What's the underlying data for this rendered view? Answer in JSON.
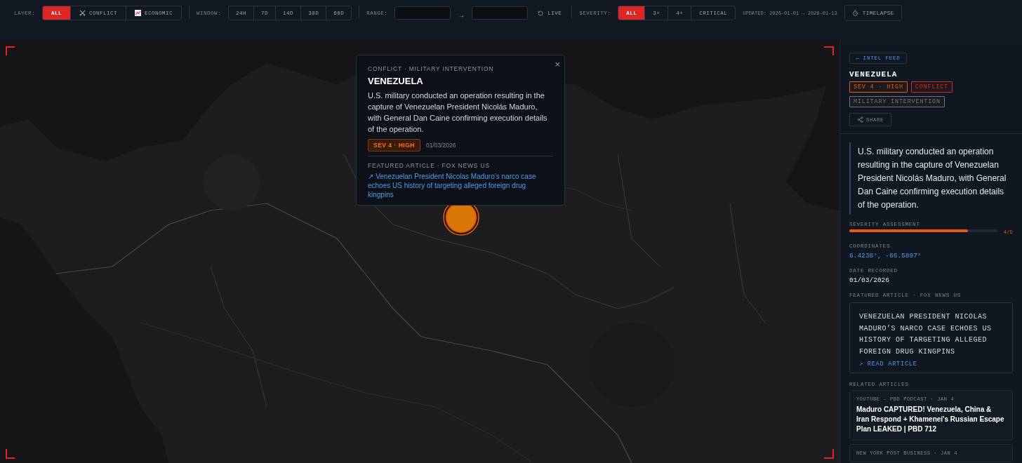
{
  "toolbar": {
    "layer": {
      "label": "LAYER:",
      "options": [
        {
          "label": "ALL",
          "kind": "plain",
          "selected": true
        },
        {
          "label": "CONFLICT",
          "kind": "conflict",
          "selected": false
        },
        {
          "label": "ECONOMIC",
          "kind": "economic",
          "selected": false
        }
      ]
    },
    "window": {
      "label": "WINDOW:",
      "options": [
        {
          "label": "24H",
          "selected": false
        },
        {
          "label": "7D",
          "selected": false
        },
        {
          "label": "14D",
          "selected": false
        },
        {
          "label": "30D",
          "selected": false
        },
        {
          "label": "60D",
          "selected": false
        }
      ]
    },
    "range": {
      "label": "RANGE:",
      "arrow": "→"
    },
    "live": {
      "label": "LIVE"
    },
    "severity": {
      "label": "SEVERITY:",
      "options": [
        {
          "label": "ALL",
          "selected": true
        },
        {
          "label": "3+",
          "selected": false
        },
        {
          "label": "4+",
          "selected": false
        },
        {
          "label": "CRITICAL",
          "selected": false
        }
      ]
    },
    "updated": "UPDATED: 2026-01-01 → 2026-01-13",
    "timelapse": {
      "label": "TIMELAPSE"
    }
  },
  "popup": {
    "category": "CONFLICT · MILITARY INTERVENTION",
    "close": "×",
    "title": "VENEZUELA",
    "description": "U.S. military conducted an operation resulting in the capture of Venezuelan President Nicolás Maduro, with General Dan Caine confirming execution details of the operation.",
    "severity": "SEV 4 · HIGH",
    "date": "01/03/2026",
    "featured_label": "FEATURED ARTICLE · FOX NEWS US",
    "featured_link": "↗ Venezuelan President Nicolas Maduro’s narco case echoes US history of targeting alleged foreign drug kingpins"
  },
  "panel": {
    "back": "← INTEL FEED",
    "title": "VENEZUELA",
    "tags": [
      {
        "label": "SEV 4 · HIGH",
        "color": "#ea580c"
      },
      {
        "label": "CONFLICT",
        "color": "#dc2626"
      },
      {
        "label": "MILITARY INTERVENTION",
        "color": "#64748b"
      }
    ],
    "share": "SHARE",
    "description": "U.S. military conducted an operation resulting in the capture of Venezuelan President Nicolás Maduro, with General Dan Caine confirming execution details of the operation.",
    "severity": {
      "label": "SEVERITY ASSESSMENT",
      "level": 0.8,
      "reading": "4/5"
    },
    "coordinates": {
      "label": "COORDINATES",
      "value": "6.4238°, -66.5897°"
    },
    "date": {
      "label": "DATE RECORDED",
      "value": "01/03/2026"
    },
    "featured": {
      "label": "FEATURED ARTICLE · FOX NEWS US",
      "headline": "VENEZUELAN PRESIDENT NICOLAS MADURO’S NARCO CASE ECHOES US HISTORY OF TARGETING ALLEGED FOREIGN DRUG KINGPINS",
      "link": "↗ READ ARTICLE"
    },
    "related_label": "RELATED ARTICLES",
    "related": [
      {
        "source": "YOUTUBE - PBD PODCAST · JAN 4",
        "title": "Maduro CAPTURED! Venezuela, China & Iran Respond + Khamenei's Russian Escape Plan LEAKED | PBD 712"
      },
      {
        "source": "NEW YORK POST BUSINESS · JAN 4"
      }
    ]
  }
}
